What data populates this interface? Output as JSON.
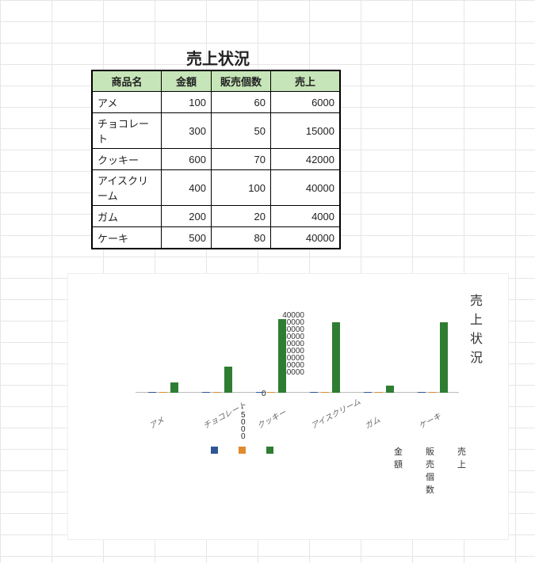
{
  "title": "売上状況",
  "table": {
    "headers": [
      "商品名",
      "金額",
      "販売個数",
      "売上"
    ],
    "rows": [
      {
        "name": "アメ",
        "price": 100,
        "qty": 60,
        "sales": 6000
      },
      {
        "name": "チョコレート",
        "price": 300,
        "qty": 50,
        "sales": 15000
      },
      {
        "name": "クッキー",
        "price": 600,
        "qty": 70,
        "sales": 42000
      },
      {
        "name": "アイスクリーム",
        "price": 400,
        "qty": 100,
        "sales": 40000
      },
      {
        "name": "ガム",
        "price": 200,
        "qty": 20,
        "sales": 4000
      },
      {
        "name": "ケーキ",
        "price": 500,
        "qty": 80,
        "sales": 40000
      }
    ]
  },
  "chart_data": {
    "type": "bar",
    "title": "売上状況",
    "categories": [
      "アメ",
      "チョコレート",
      "クッキー",
      "アイスクリーム",
      "ガム",
      "ケーキ"
    ],
    "series": [
      {
        "name": "金額",
        "values": [
          100,
          300,
          600,
          400,
          200,
          500
        ]
      },
      {
        "name": "販売個数",
        "values": [
          60,
          50,
          70,
          100,
          20,
          80
        ]
      },
      {
        "name": "売上",
        "values": [
          6000,
          15000,
          42000,
          40000,
          4000,
          40000
        ]
      }
    ],
    "ylim": [
      -5000,
      45000
    ],
    "y_ticks": [
      45000,
      40000,
      35000,
      30000,
      25000,
      20000,
      15000,
      10000,
      5000,
      0,
      -5000
    ],
    "legend": [
      "金額",
      "販売個数",
      "売上"
    ]
  }
}
